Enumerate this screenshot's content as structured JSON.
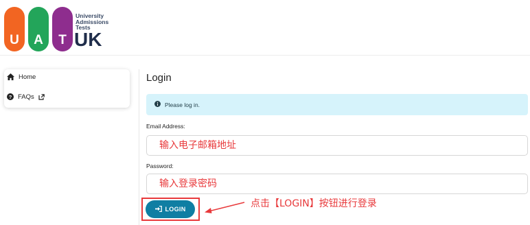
{
  "logo": {
    "letters": [
      "U",
      "A",
      "T"
    ],
    "small_lines": [
      "University",
      "Admissions",
      "Tests"
    ],
    "big": "UK",
    "colors": {
      "u": "#f26522",
      "a": "#23a55a",
      "t": "#8e2d8e",
      "text": "#1f2d4a"
    }
  },
  "sidebar": {
    "items": [
      {
        "label": "Home",
        "icon": "home-icon"
      },
      {
        "label": "FAQs",
        "icon": "question-circle-icon",
        "trailing_icon": "external-link-icon"
      }
    ]
  },
  "main": {
    "title": "Login",
    "alert": {
      "icon": "info-circle-icon",
      "text": "Please log in."
    },
    "email": {
      "label": "Email Address:",
      "placeholder": "输入电子邮箱地址"
    },
    "password": {
      "label": "Password:",
      "placeholder": "输入登录密码"
    },
    "login_button": {
      "label": "LOGIN",
      "icon": "sign-in-icon",
      "color": "#0f7ea3"
    }
  },
  "annotation": {
    "text": "点击【LOGIN】按钮进行登录",
    "color": "#e8393b"
  }
}
